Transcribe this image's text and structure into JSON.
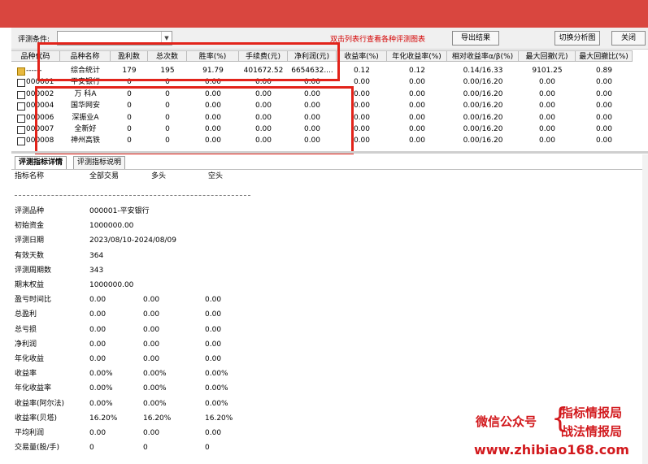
{
  "toolbar": {
    "condition_label": "评测条件:",
    "hint": "双击列表行查看各种评测图表",
    "export_label": "导出结果",
    "switch_label": "切换分析图",
    "close_label": "关闭"
  },
  "table": {
    "headers": [
      "品种代码",
      "品种名称",
      "盈利数",
      "总次数",
      "胜率(%)",
      "手续费(元)",
      "净利润(元)",
      "收益率(%)",
      "年化收益率(%)",
      "相对收益率α/β(%)",
      "最大回撤(元)",
      "最大回撤比(%)"
    ],
    "rows": [
      [
        "------",
        "综合统计",
        "179",
        "195",
        "91.79",
        "401672.52",
        "6654632....",
        "0.12",
        "0.12",
        "0.14/16.33",
        "9101.25",
        "0.89"
      ],
      [
        "000001",
        "平安银行",
        "0",
        "0",
        "0.00",
        "0.00",
        "0.00",
        "0.00",
        "0.00",
        "0.00/16.20",
        "0.00",
        "0.00"
      ],
      [
        "000002",
        "万 科A",
        "0",
        "0",
        "0.00",
        "0.00",
        "0.00",
        "0.00",
        "0.00",
        "0.00/16.20",
        "0.00",
        "0.00"
      ],
      [
        "000004",
        "国华网安",
        "0",
        "0",
        "0.00",
        "0.00",
        "0.00",
        "0.00",
        "0.00",
        "0.00/16.20",
        "0.00",
        "0.00"
      ],
      [
        "000006",
        "深振业A",
        "0",
        "0",
        "0.00",
        "0.00",
        "0.00",
        "0.00",
        "0.00",
        "0.00/16.20",
        "0.00",
        "0.00"
      ],
      [
        "000007",
        "全新好",
        "0",
        "0",
        "0.00",
        "0.00",
        "0.00",
        "0.00",
        "0.00",
        "0.00/16.20",
        "0.00",
        "0.00"
      ],
      [
        "000008",
        "神州高铁",
        "0",
        "0",
        "0.00",
        "0.00",
        "0.00",
        "0.00",
        "0.00",
        "0.00/16.20",
        "0.00",
        "0.00"
      ]
    ]
  },
  "tabs": [
    "评测指标详情",
    "评测指标说明"
  ],
  "detail": {
    "head": [
      "指标名称",
      "全部交易",
      "多头",
      "空头"
    ],
    "lines": [
      [
        "评测品种",
        "000001-平安银行"
      ],
      [
        "初始资金",
        "1000000.00"
      ],
      [
        "评测日期",
        "2023/08/10-2024/08/09"
      ],
      [
        "有效天数",
        "364"
      ],
      [
        "评测周期数",
        "343"
      ],
      [
        "期末权益",
        "1000000.00"
      ],
      [
        "盈亏时间比",
        "0.00",
        "0.00",
        "0.00"
      ],
      [
        "总盈利",
        "0.00",
        "0.00",
        "0.00"
      ],
      [
        "总亏损",
        "0.00",
        "0.00",
        "0.00"
      ],
      [
        "净利润",
        "0.00",
        "0.00",
        "0.00"
      ],
      [
        "年化收益",
        "0.00",
        "0.00",
        "0.00"
      ],
      [
        "收益率",
        "0.00%",
        "0.00%",
        "0.00%"
      ],
      [
        "年化收益率",
        "0.00%",
        "0.00%",
        "0.00%"
      ],
      [
        "收益率(阿尔法)",
        "0.00%",
        "0.00%",
        "0.00%"
      ],
      [
        "收益率(贝塔)",
        "16.20%",
        "16.20%",
        "16.20%"
      ],
      [
        "平均利润",
        "0.00",
        "0.00",
        "0.00"
      ],
      [
        "交易量(股/手)",
        "0",
        "0",
        "0"
      ]
    ]
  },
  "watermark": {
    "wechat": "微信公众号",
    "brand1": "指标情报局",
    "brand2": "战法情报局",
    "url": "www.zhibiao168.com"
  },
  "colors": {
    "titlebar": "#d9463f",
    "highlight": "#e2231a",
    "hint": "#d40000"
  }
}
